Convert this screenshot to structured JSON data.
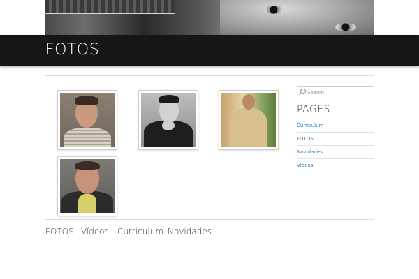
{
  "header": {
    "banner_image": "portrait-banner",
    "page_title": "FOTOS",
    "title_bar_color": "#161616"
  },
  "gallery": {
    "photos": [
      {
        "alt": "portrait-striped-sweater"
      },
      {
        "alt": "portrait-black-and-white-hand-on-chin"
      },
      {
        "alt": "portrait-beige-sweater-outdoor"
      },
      {
        "alt": "portrait-smiling-jacket"
      }
    ]
  },
  "sidebar": {
    "search_placeholder": "Search",
    "pages_title": "PAGES",
    "pages": [
      "Curriculum",
      "FOTOS",
      "Novidades",
      "Vídeos"
    ],
    "link_color": "#2b7bb9"
  },
  "footer_nav": {
    "items": [
      "FOTOS",
      "Vídeos",
      "Curriculum",
      "Novidades"
    ]
  }
}
